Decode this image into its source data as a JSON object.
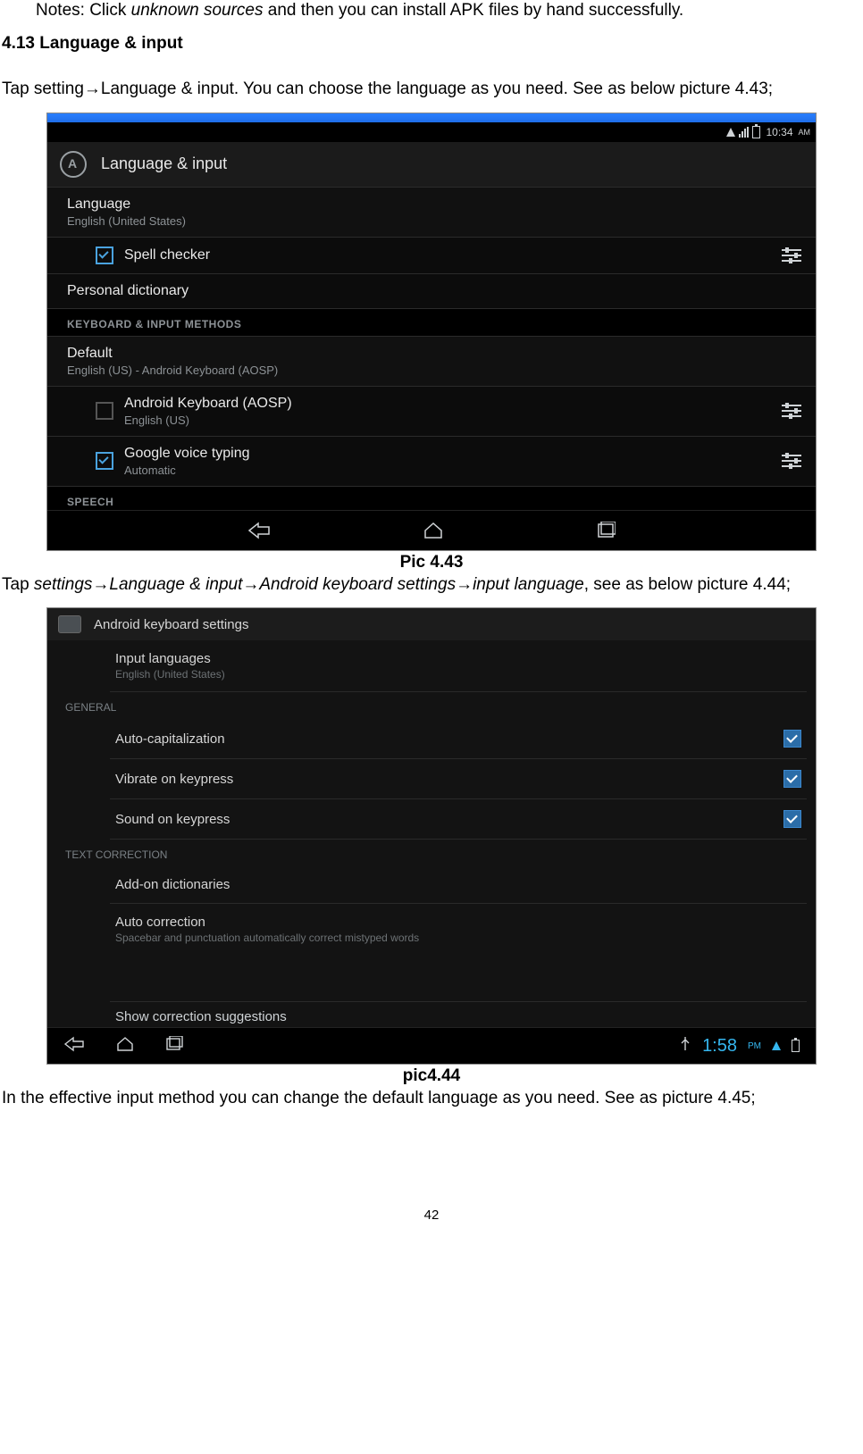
{
  "doc": {
    "notes_line": "Notes: Click unknown sources and then you can install APK files by hand successfully.",
    "notes_prefix": "Notes: Click ",
    "notes_italic": "unknown sources",
    "notes_suffix": " and then you can install APK files by hand successfully.",
    "heading": "4.13 Language & input",
    "para1_pre": "Tap setting",
    "arrow": "→",
    "para1_mid": "Language & input. You can choose the language as you need. See as below picture 4.43;",
    "caption1": "Pic 4.43",
    "para2_pre": "Tap ",
    "para2_i1": "settings",
    "para2_i2": "Language & input",
    "para2_i3": "Android keyboard settings",
    "para2_i4": "input language",
    "para2_suffix": ", see as below picture 4.44;",
    "caption2": "pic4.44",
    "para3": "In the effective input method you can change the default language as you need. See as picture 4.45;",
    "page_number": "42"
  },
  "shot1": {
    "time": "10:34",
    "time_suffix": "AM",
    "title": "Language & input",
    "language_label": "Language",
    "language_value": "English (United States)",
    "spell_checker": "Spell checker",
    "personal_dict": "Personal dictionary",
    "section_kim": "KEYBOARD & INPUT METHODS",
    "default_label": "Default",
    "default_value": "English (US) - Android Keyboard (AOSP)",
    "aosp_label": "Android Keyboard (AOSP)",
    "aosp_value": "English (US)",
    "gvoice_label": "Google voice typing",
    "gvoice_value": "Automatic",
    "section_speech": "SPEECH"
  },
  "shot2": {
    "title": "Android keyboard settings",
    "input_lang_label": "Input languages",
    "input_lang_value": "English (United States)",
    "section_general": "GENERAL",
    "auto_cap": "Auto-capitalization",
    "vibrate": "Vibrate on keypress",
    "sound": "Sound on keypress",
    "section_text": "TEXT CORRECTION",
    "addon": "Add-on dictionaries",
    "auto_corr": "Auto correction",
    "auto_corr_sub": "Spacebar and punctuation automatically correct mistyped words",
    "show_sugg": "Show correction suggestions",
    "clock": "1:58",
    "clock_suffix": "PM"
  }
}
